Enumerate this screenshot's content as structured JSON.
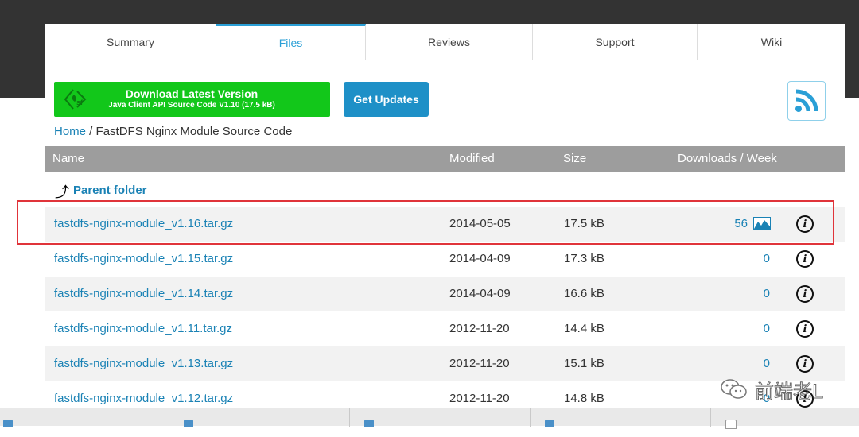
{
  "tabs": [
    {
      "label": "Summary",
      "active": false
    },
    {
      "label": "Files",
      "active": true
    },
    {
      "label": "Reviews",
      "active": false
    },
    {
      "label": "Support",
      "active": false
    },
    {
      "label": "Wiki",
      "active": false
    }
  ],
  "download": {
    "title": "Download Latest Version",
    "subtitle": "Java Client API Source Code V1.10 (17.5 kB)",
    "icon": "sourceforge-logo-icon"
  },
  "get_updates_label": "Get Updates",
  "rss_icon": "rss-icon",
  "breadcrumb": {
    "home": "Home",
    "separator": " / ",
    "current": "FastDFS Nginx Module Source Code"
  },
  "table": {
    "headers": {
      "name": "Name",
      "modified": "Modified",
      "size": "Size",
      "downloads": "Downloads / Week"
    },
    "parent_folder_label": "Parent folder",
    "rows": [
      {
        "name": "fastdfs-nginx-module_v1.16.tar.gz",
        "modified": "2014-05-05",
        "size": "17.5 kB",
        "downloads": "56",
        "has_chart": true
      },
      {
        "name": "fastdfs-nginx-module_v1.15.tar.gz",
        "modified": "2014-04-09",
        "size": "17.3 kB",
        "downloads": "0",
        "has_chart": false
      },
      {
        "name": "fastdfs-nginx-module_v1.14.tar.gz",
        "modified": "2014-04-09",
        "size": "16.6 kB",
        "downloads": "0",
        "has_chart": false
      },
      {
        "name": "fastdfs-nginx-module_v1.11.tar.gz",
        "modified": "2012-11-20",
        "size": "14.4 kB",
        "downloads": "0",
        "has_chart": false
      },
      {
        "name": "fastdfs-nginx-module_v1.13.tar.gz",
        "modified": "2012-11-20",
        "size": "15.1 kB",
        "downloads": "0",
        "has_chart": false
      },
      {
        "name": "fastdfs-nginx-module_v1.12.tar.gz",
        "modified": "2012-11-20",
        "size": "14.8 kB",
        "downloads": "0",
        "has_chart": false
      }
    ],
    "info_glyph": "i"
  },
  "watermark": "前端老L",
  "colors": {
    "accent": "#2a9fd6",
    "link": "#1a82b5",
    "download_green": "#12c71a",
    "updates_blue": "#1e90c7",
    "header_gray": "#9d9d9d",
    "highlight_red": "#e0343a"
  }
}
